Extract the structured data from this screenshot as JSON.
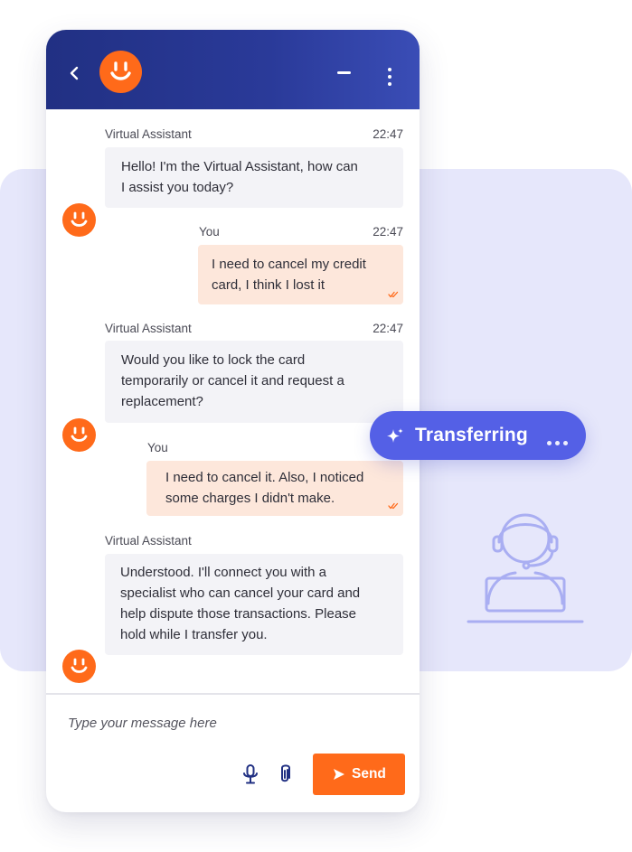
{
  "colors": {
    "header": "#25348d",
    "accent": "#ff6a1a",
    "pill": "#5460e6",
    "panel": "#e6e7fb",
    "bot_bubble": "#f3f3f7",
    "user_bubble": "#fde7db"
  },
  "header": {
    "back_icon": "chevron-left-icon",
    "avatar_icon": "smiley-icon",
    "minimize_icon": "minimize-icon",
    "menu_icon": "vertical-dots-icon"
  },
  "messages": [
    {
      "sender": "Virtual Assistant",
      "time": "22:47",
      "lines": [
        "Hello! I'm the Virtual Assistant, how can",
        "I assist you today?"
      ]
    },
    {
      "sender": "You",
      "time": "22:47",
      "lines": [
        "I need to cancel my credit",
        "card, I think I lost it"
      ]
    },
    {
      "sender": "Virtual Assistant",
      "time": "22:47",
      "lines": [
        "Would you like to lock the card",
        "temporarily or cancel it and request a",
        "replacement?"
      ]
    },
    {
      "sender": "You",
      "time": "",
      "lines": [
        "I need to cancel it. Also, I noticed",
        "some charges I didn't make."
      ]
    },
    {
      "sender": "Virtual Assistant",
      "time": "",
      "lines": [
        "Understood. I'll connect you with a",
        "specialist who can cancel your card and",
        "help dispute those transactions. Please",
        "hold while I transfer you."
      ]
    }
  ],
  "composer": {
    "placeholder": "Type your message here",
    "mic_icon": "microphone-icon",
    "attach_icon": "paperclip-icon",
    "send_label": "Send"
  },
  "transfer": {
    "label": "Transferring",
    "icon": "sparkle-icon"
  },
  "illustration": {
    "icon": "support-agent-icon"
  }
}
